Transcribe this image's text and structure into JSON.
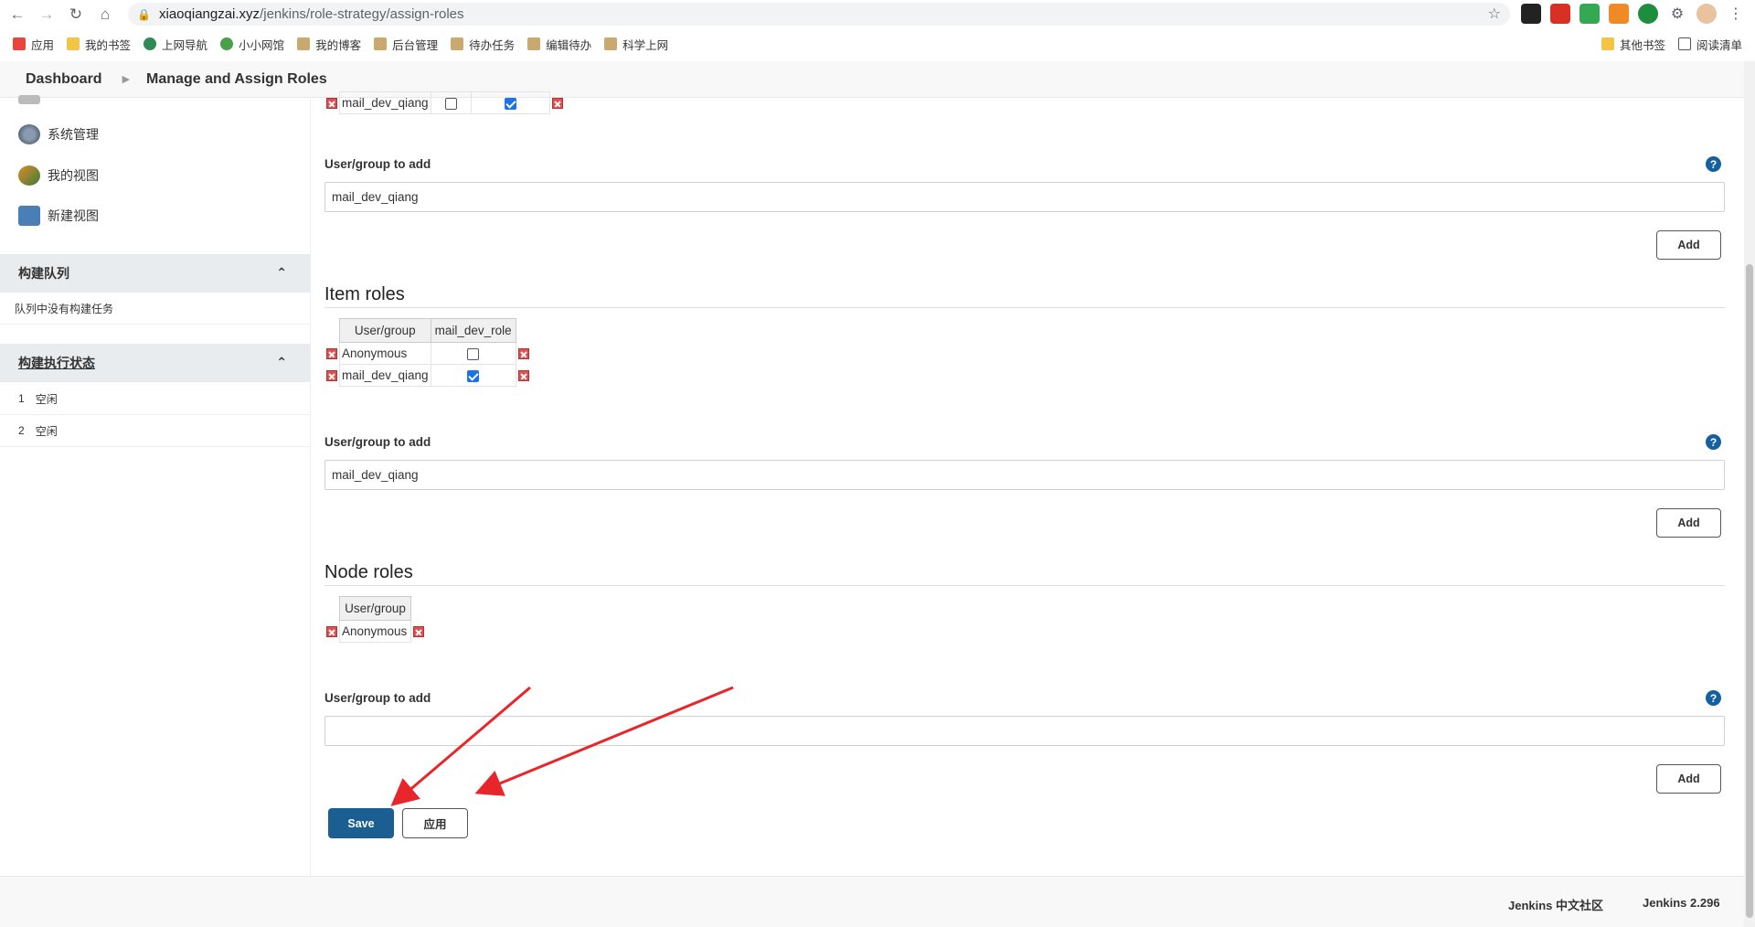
{
  "browser": {
    "url_host": "xiaoqiangzai.xyz",
    "url_path": "/jenkins/role-strategy/assign-roles",
    "bookmarks": [
      "应用",
      "我的书签",
      "上网导航",
      "小小网馆",
      "我的博客",
      "后台管理",
      "待办任务",
      "编辑待办",
      "科学上网"
    ],
    "bookmarks_right": [
      "其他书签",
      "阅读清单"
    ],
    "bookmark_colors": [
      "#e8a33a",
      "#f4c542",
      "#2e8b57",
      "#4a9f4a",
      "#c9a96e",
      "#c9a96e",
      "#c9a96e",
      "#c9a96e",
      "#c9a96e"
    ]
  },
  "breadcrumb": {
    "home": "Dashboard",
    "current": "Manage and Assign Roles"
  },
  "sidebar": {
    "links": [
      {
        "label": "系统管理",
        "icon": "gear-icon"
      },
      {
        "label": "我的视图",
        "icon": "people-icon"
      },
      {
        "label": "新建视图",
        "icon": "folder-icon"
      }
    ],
    "build_queue": {
      "title": "构建队列",
      "empty": "队列中没有构建任务"
    },
    "executors": {
      "title": "构建执行状态",
      "rows": [
        {
          "num": "1",
          "status": "空闲"
        },
        {
          "num": "2",
          "status": "空闲"
        }
      ]
    }
  },
  "global_top": {
    "user": "mail_dev_qiang"
  },
  "global_add": {
    "label": "User/group to add",
    "value": "mail_dev_qiang",
    "button": "Add"
  },
  "item_roles": {
    "title": "Item roles",
    "headers": [
      "User/group",
      "mail_dev_role"
    ],
    "rows": [
      {
        "user": "Anonymous",
        "checked": false
      },
      {
        "user": "mail_dev_qiang",
        "checked": true
      }
    ],
    "add_label": "User/group to add",
    "add_value": "mail_dev_qiang",
    "add_button": "Add"
  },
  "node_roles": {
    "title": "Node roles",
    "headers": [
      "User/group"
    ],
    "rows": [
      {
        "user": "Anonymous"
      }
    ],
    "add_label": "User/group to add",
    "add_value": "",
    "add_button": "Add"
  },
  "actions": {
    "save": "Save",
    "apply": "应用"
  },
  "footer": {
    "community": "Jenkins 中文社区",
    "version": "Jenkins 2.296"
  },
  "help_glyph": "?"
}
